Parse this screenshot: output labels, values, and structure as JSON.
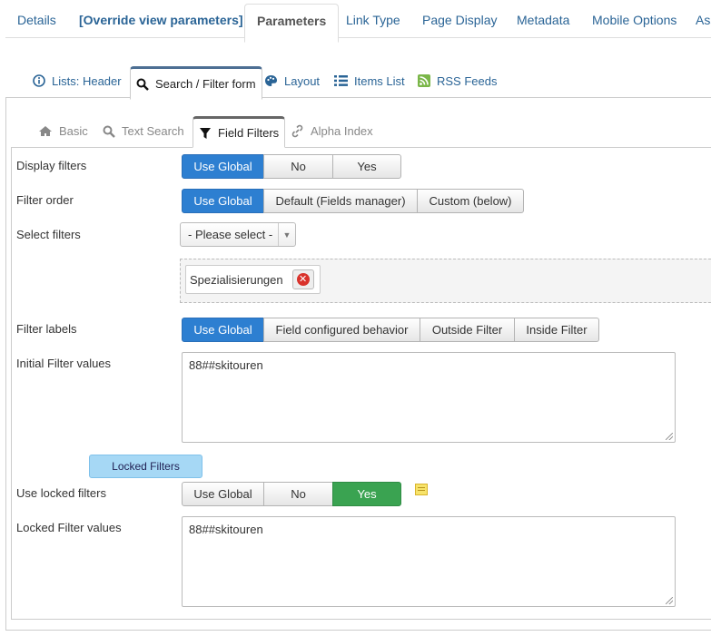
{
  "top_tabs": [
    {
      "label": "Details"
    },
    {
      "label": "[Override view parameters]"
    },
    {
      "label": "Parameters"
    },
    {
      "label": "Link Type"
    },
    {
      "label": "Page Display"
    },
    {
      "label": "Metadata"
    },
    {
      "label": "Mobile Options"
    },
    {
      "label": "Ass"
    }
  ],
  "sub_tabs": [
    {
      "label": "Lists: Header",
      "icon": "info-circle-icon"
    },
    {
      "label": "Search / Filter form",
      "icon": "search-icon"
    },
    {
      "label": "Layout",
      "icon": "palette-icon"
    },
    {
      "label": "Items List",
      "icon": "list-icon"
    },
    {
      "label": "RSS Feeds",
      "icon": "rss-icon"
    }
  ],
  "third_tabs": [
    {
      "label": "Basic",
      "icon": "home-icon"
    },
    {
      "label": "Text Search",
      "icon": "search-icon"
    },
    {
      "label": "Field Filters",
      "icon": "filter-icon"
    },
    {
      "label": "Alpha Index",
      "icon": "link-icon"
    }
  ],
  "form": {
    "display_filters": {
      "label": "Display filters",
      "options": [
        "Use Global",
        "No",
        "Yes"
      ],
      "selected": "Use Global"
    },
    "filter_order": {
      "label": "Filter order",
      "options": [
        "Use Global",
        "Default (Fields manager)",
        "Custom (below)"
      ],
      "selected": "Use Global"
    },
    "select_filters": {
      "label": "Select filters",
      "placeholder": "- Please select -",
      "chips": [
        "Spezialisierungen"
      ]
    },
    "filter_labels": {
      "label": "Filter labels",
      "options": [
        "Use Global",
        "Field configured behavior",
        "Outside Filter",
        "Inside Filter"
      ],
      "selected": "Use Global"
    },
    "initial_filter_values": {
      "label": "Initial Filter values",
      "value": "88##skitouren"
    },
    "locked_filters_header": "Locked Filters",
    "use_locked_filters": {
      "label": "Use locked filters",
      "options": [
        "Use Global",
        "No",
        "Yes"
      ],
      "selected": "Yes"
    },
    "locked_filter_values": {
      "label": "Locked Filter values",
      "value": "88##skitouren"
    }
  },
  "colors": {
    "primary": "#2d7fd1",
    "success": "#3aa351",
    "link": "#2a6496",
    "pill": "#a6d8f5"
  }
}
